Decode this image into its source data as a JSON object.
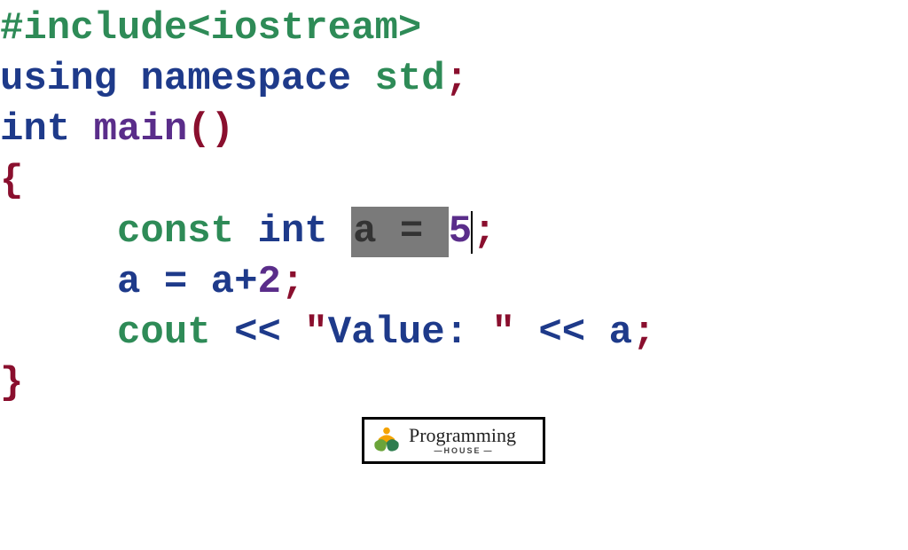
{
  "code": {
    "line1": {
      "include": "#include",
      "header": "<iostream>"
    },
    "line2": {
      "using": "using",
      "namespace": "namespace",
      "std": "std",
      "semi": ";"
    },
    "line3": {
      "int": "int",
      "main": "main",
      "lparen": "(",
      "rparen": ")"
    },
    "line4": {
      "lbrace": "{"
    },
    "line5": {
      "const": "const",
      "int": "int",
      "sel_a": "a",
      "sel_eq": "=",
      "five": "5",
      "semi": ";"
    },
    "line6": {
      "a1": "a",
      "eq": "=",
      "a2": "a",
      "plus": "+",
      "two": "2",
      "semi": ";"
    },
    "line7": {
      "cout": "cout",
      "ins1": "<<",
      "q1": "\"",
      "str": "Value: ",
      "q2": "\"",
      "ins2": "<<",
      "a": "a",
      "semi": ";"
    },
    "line8": {
      "rbrace": "}"
    }
  },
  "logo": {
    "main": "Programming",
    "sub": "HOUSE"
  }
}
